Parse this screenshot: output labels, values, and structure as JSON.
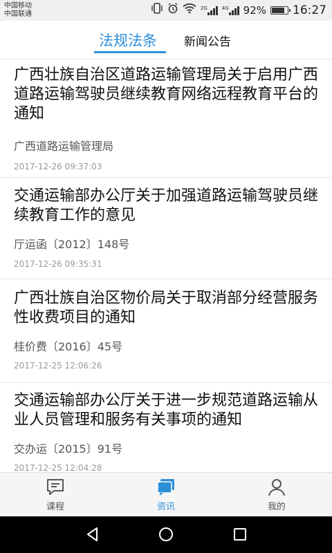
{
  "status_bar": {
    "carrier1": "中国移动",
    "carrier2": "中国联通",
    "network1": "2G",
    "network2": "4G",
    "battery_text": "92%",
    "battery_level": 0.92,
    "time": "16:27",
    "icons": [
      "vibrate-icon",
      "alarm-icon",
      "wifi-icon",
      "signal-icon",
      "battery-icon"
    ]
  },
  "tabs": [
    {
      "label": "法规法条",
      "active": true
    },
    {
      "label": "新闻公告",
      "active": false
    }
  ],
  "accent_color": "#2d8fd8",
  "items": [
    {
      "title": "广西壮族自治区道路运输管理局关于启用广西道路运输驾驶员继续教育网络远程教育平台的通知",
      "source": "广西道路运输管理局",
      "date": "2017-12-26 09:37:03"
    },
    {
      "title": "交通运输部办公厅关于加强道路运输驾驶员继续教育工作的意见",
      "source": "厅运函〔2012〕148号",
      "date": "2017-12-26 09:35:31"
    },
    {
      "title": "广西壮族自治区物价局关于取消部分经营服务性收费项目的通知",
      "source": "桂价费〔2016〕45号",
      "date": "2017-12-25 12:06:26"
    },
    {
      "title": "交通运输部办公厅关于进一步规范道路运输从业人员管理和服务有关事项的通知",
      "source": "交办运〔2015〕91号",
      "date": "2017-12-25 12:04:28"
    }
  ],
  "bottom_nav": [
    {
      "label": "课程",
      "icon": "chat-icon",
      "active": false
    },
    {
      "label": "资讯",
      "icon": "news-icon",
      "active": true
    },
    {
      "label": "我的",
      "icon": "user-icon",
      "active": false
    }
  ],
  "system_nav": [
    "back-icon",
    "home-icon",
    "recents-icon"
  ]
}
